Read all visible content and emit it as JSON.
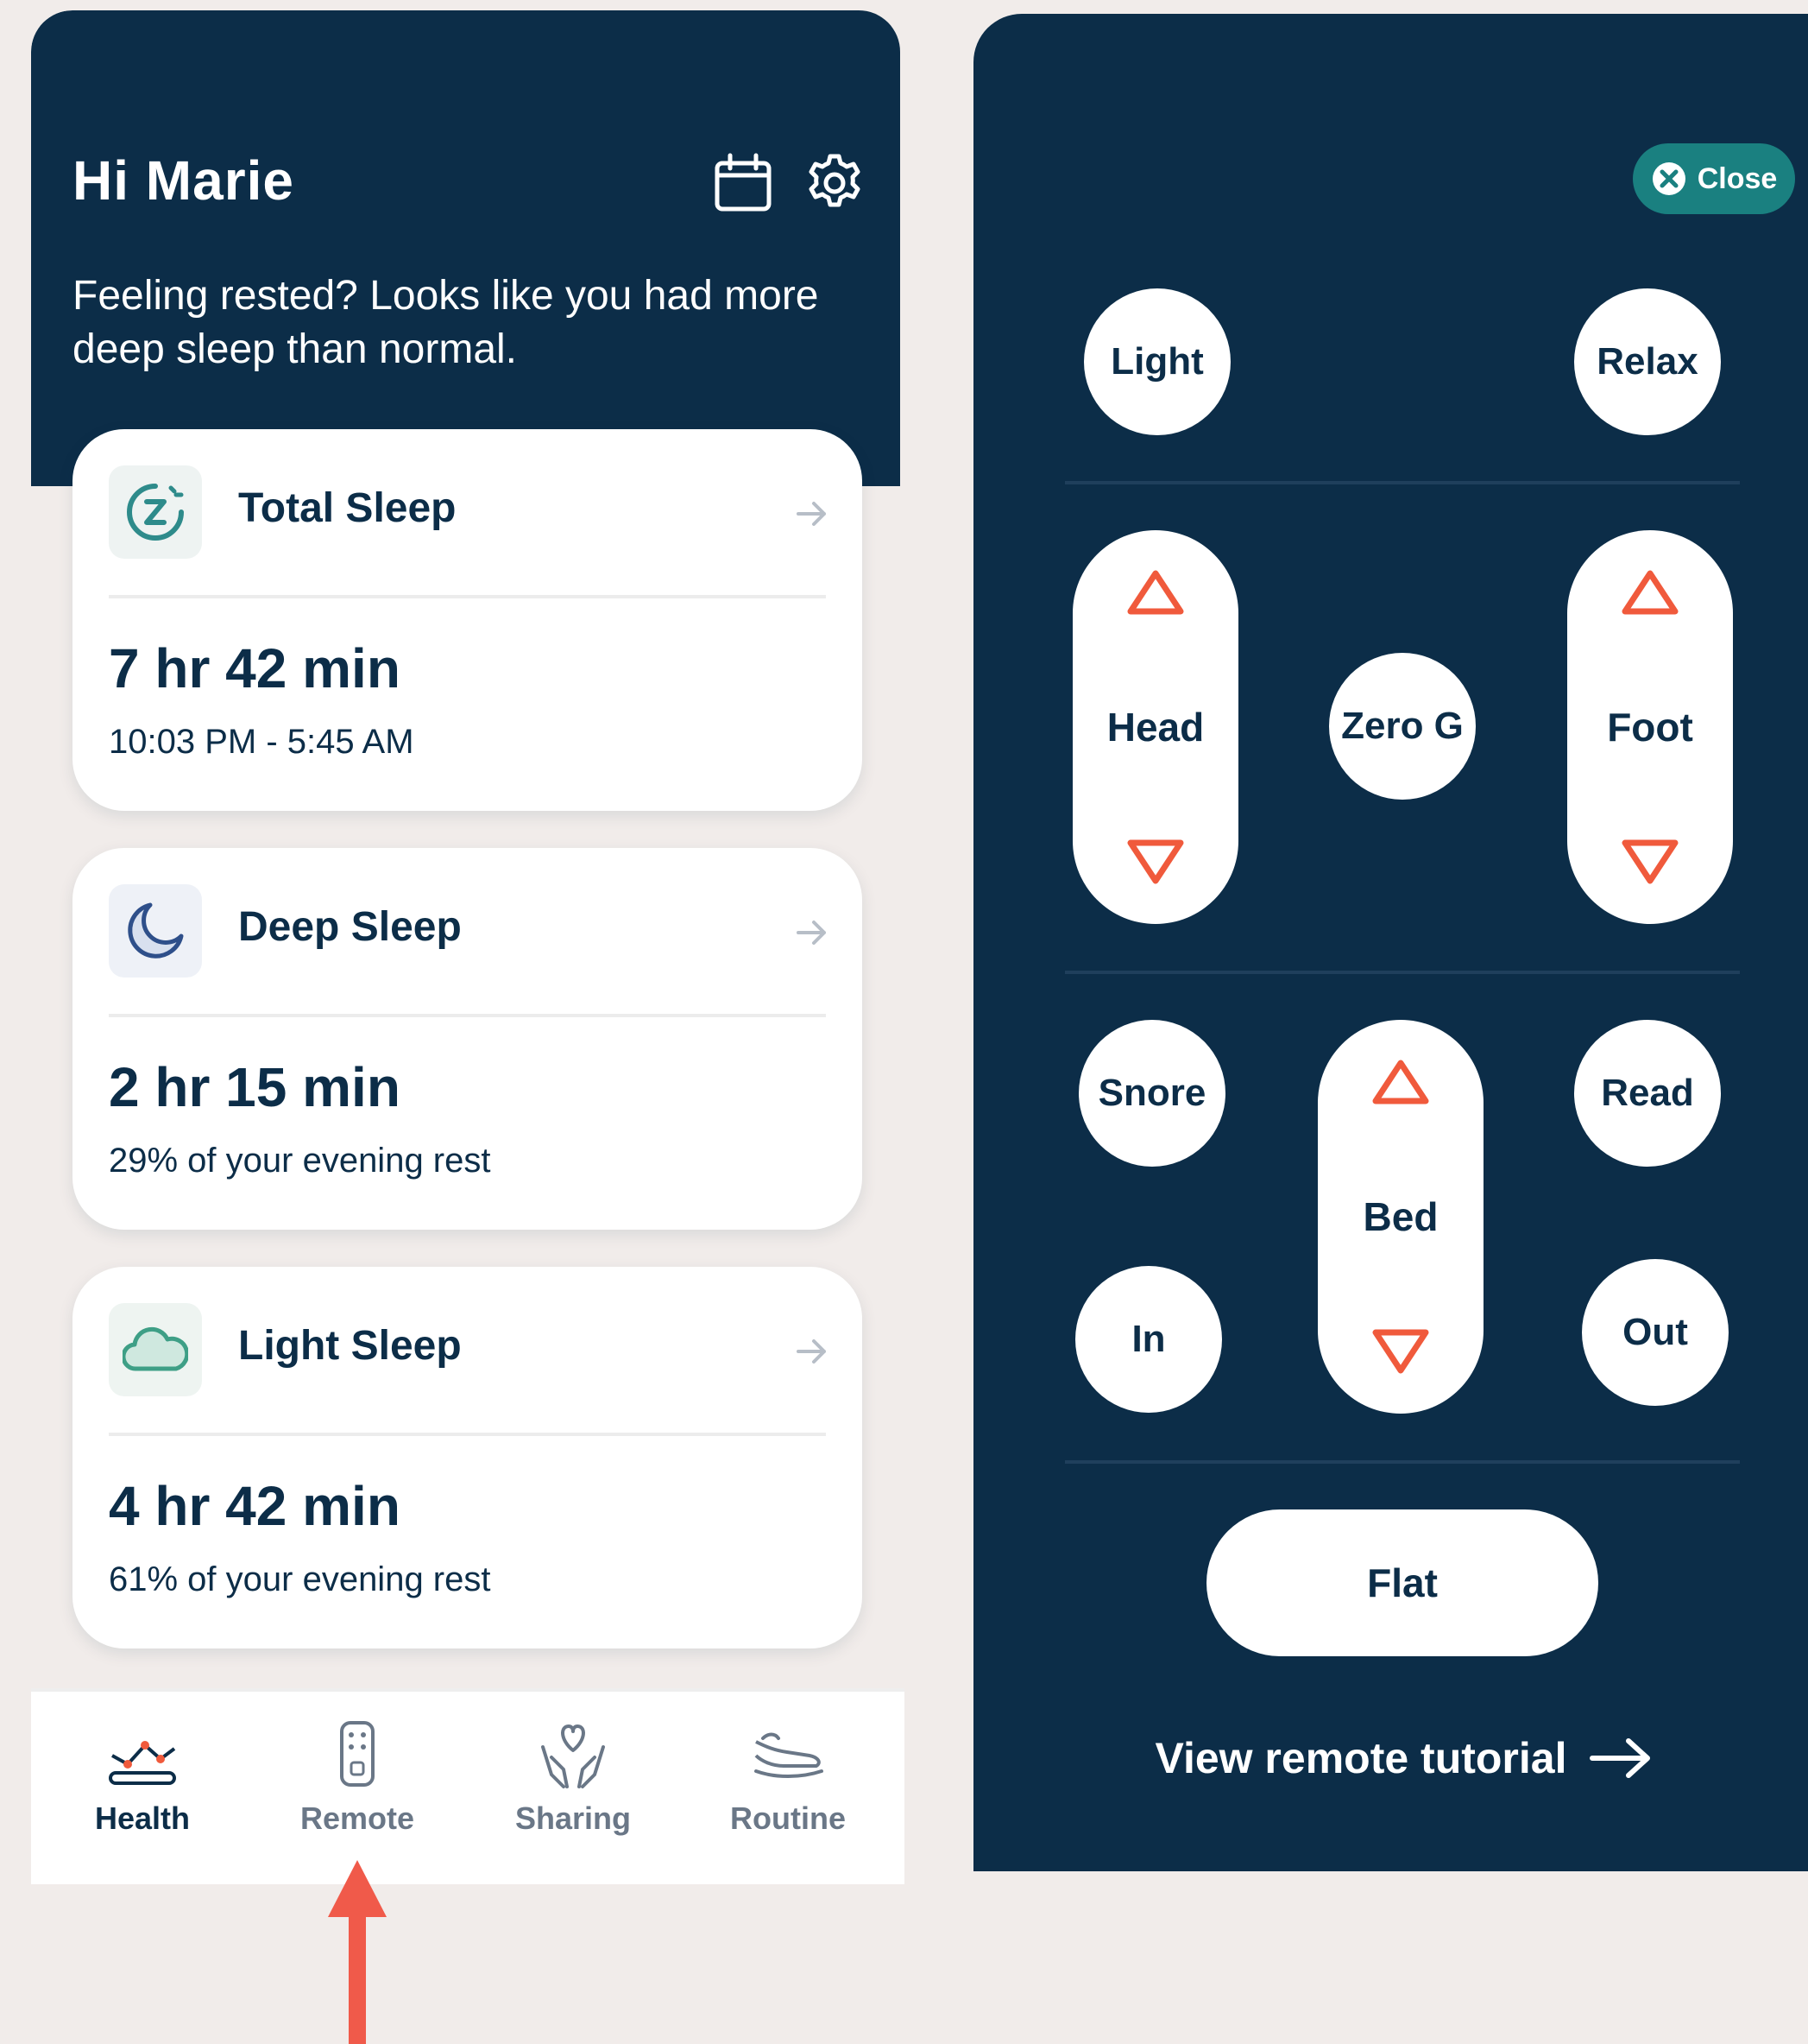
{
  "left_screen": {
    "header": {
      "greeting": "Hi Marie",
      "message": "Feeling rested? Looks like you had more deep sleep than normal.",
      "icons": [
        "calendar-icon",
        "gear-icon"
      ]
    },
    "cards": [
      {
        "title": "Total Sleep",
        "icon": "sleep-z-icon",
        "value": "7 hr 42 min",
        "sub": "10:03 PM - 5:45 AM",
        "accent": "#2e8b8b",
        "icon_bg": "#eef3f2"
      },
      {
        "title": "Deep Sleep",
        "icon": "moon-icon",
        "value": "2 hr 15 min",
        "sub": "29% of your evening rest",
        "accent": "#2e4f8a",
        "icon_bg": "#eef1f7"
      },
      {
        "title": "Light Sleep",
        "icon": "cloud-icon",
        "value": "4 hr 42 min",
        "sub": "61% of your evening rest",
        "accent": "#3e9f86",
        "icon_bg": "#eef4f1"
      }
    ],
    "bottom_nav": [
      {
        "label": "Health",
        "icon": "health-chart-icon",
        "active": true
      },
      {
        "label": "Remote",
        "icon": "remote-icon",
        "active": false
      },
      {
        "label": "Sharing",
        "icon": "sharing-hands-heart-icon",
        "active": false
      },
      {
        "label": "Routine",
        "icon": "routine-bed-icon",
        "active": false
      }
    ]
  },
  "right_screen": {
    "close_label": "Close",
    "buttons": {
      "light": "Light",
      "relax": "Relax",
      "head": "Head",
      "zero_g": "Zero G",
      "foot": "Foot",
      "snore": "Snore",
      "bed": "Bed",
      "read": "Read",
      "in": "In",
      "out": "Out",
      "flat": "Flat"
    },
    "tutorial_label": "View remote tutorial"
  },
  "colors": {
    "navy": "#0c2d48",
    "arrow_accent": "#f05a3c",
    "close_teal": "#1a8080",
    "pointer_arrow": "#f05a4a"
  }
}
